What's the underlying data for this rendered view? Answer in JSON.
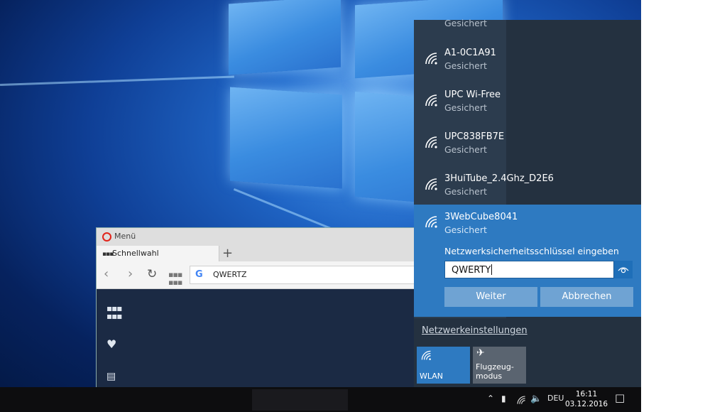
{
  "opera": {
    "menu_label": "Menü",
    "tab_label": "Schnellwahl",
    "new_tab_glyph": "+",
    "search_engine_glyph": "G",
    "address_value": "QWERTZ"
  },
  "network_flyout": {
    "top_partial_status": "Gesichert",
    "networks": [
      {
        "name": "A1-0C1A91",
        "status": "Gesichert"
      },
      {
        "name": "UPC Wi-Free",
        "status": "Gesichert"
      },
      {
        "name": "UPC838FB7E",
        "status": "Gesichert"
      },
      {
        "name": "3HuiTube_2.4Ghz_D2E6",
        "status": "Gesichert"
      }
    ],
    "active_network": {
      "name": "3WebCube8041",
      "status": "Gesichert",
      "prompt": "Netzwerksicherheitsschlüssel eingeben",
      "password_value": "QWERTY",
      "next_label": "Weiter",
      "cancel_label": "Abbrechen"
    },
    "settings_link": "Netzwerkeinstellungen",
    "tiles": [
      {
        "label": "WLAN",
        "icon": "wifi-icon",
        "active": true,
        "color": "#2e7ac1"
      },
      {
        "label": "Flugzeug-\nmodus",
        "icon": "airplane-icon",
        "active": false,
        "color": "#5a6470"
      }
    ]
  },
  "taskbar": {
    "language": "DEU",
    "time": "16:11",
    "date": "03.12.2016"
  },
  "colors": {
    "accent": "#2e7ac1",
    "flyout_bg": "#243140",
    "button": "#6fa3d3"
  }
}
